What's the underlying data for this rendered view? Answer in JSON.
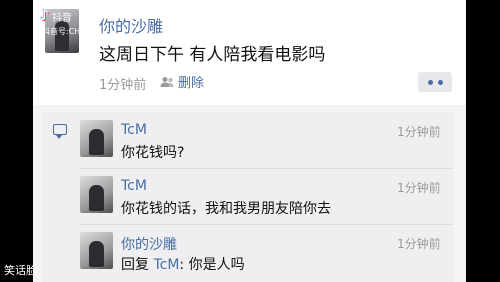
{
  "post": {
    "author": "你的沙雕",
    "text": "这周日下午  有人陪我看电影吗",
    "time": "1分钟前",
    "delete_label": "删除"
  },
  "comments": [
    {
      "name": "TcM",
      "time": "1分钟前",
      "text": "你花钱吗?"
    },
    {
      "name": "TcM",
      "time": "1分钟前",
      "text": "你花钱的话，我和我男朋友陪你去"
    },
    {
      "name": "你的沙雕",
      "time": "1分钟前",
      "reply_prefix": "回复",
      "reply_to": "TcM",
      "text": ": 你是人吗"
    }
  ],
  "watermark": "笑话脸",
  "tiktok": {
    "brand": "抖音",
    "sub": "抖音号:CHN..."
  },
  "colors": {
    "link": "#4a6ea3",
    "meta": "#9a9a9a"
  }
}
